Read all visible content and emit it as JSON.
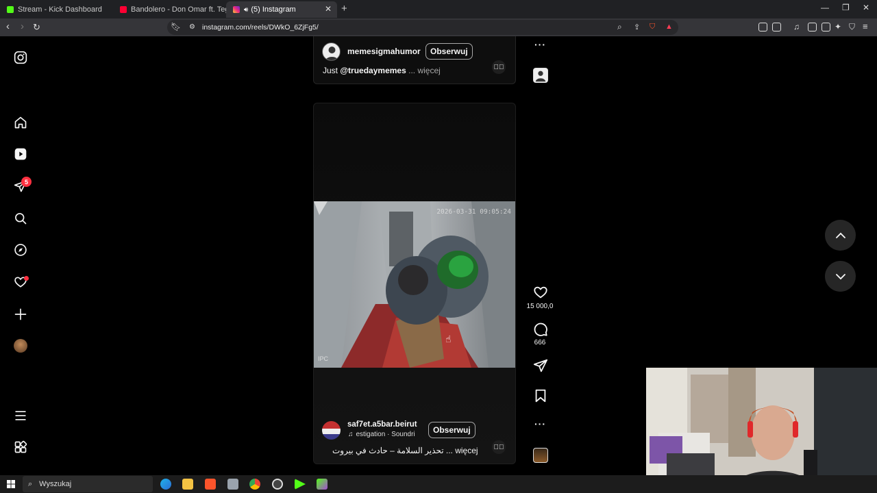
{
  "browser": {
    "tabs": [
      {
        "title": "Stream - Kick Dashboard",
        "favicon_color": "#53fc18"
      },
      {
        "title": "Bandolero - Don Omar ft. Tego Caldera",
        "favicon_color": "#ff0033"
      },
      {
        "title": "(5) Instagram",
        "favicon_color": "#d6249f"
      }
    ],
    "url": "instagram.com/reels/DWkO_6ZjFg5/"
  },
  "sidebar": {
    "notification_count": "5"
  },
  "top_reel": {
    "username": "memesigmahumor",
    "follow_label": "Obserwuj",
    "caption_prefix": "Just",
    "caption_mention": "@truedaymemes",
    "more_label": "... więcej"
  },
  "reel": {
    "timestamp": "2026-03-31 09:05:24",
    "cam_label": "IPC",
    "username": "saf7et.a5bar.beirut",
    "follow_label": "Obserwuj",
    "music_label": "estigation · Soundri",
    "caption": "تحذير السلامة – حادث في بيروت ... więcej"
  },
  "actions": {
    "likes": "15 000,0",
    "comments": "666"
  },
  "taskbar": {
    "search_placeholder": "Wyszukaj"
  },
  "colors": {
    "accent_badge": "#ff3040",
    "background": "#000000"
  }
}
